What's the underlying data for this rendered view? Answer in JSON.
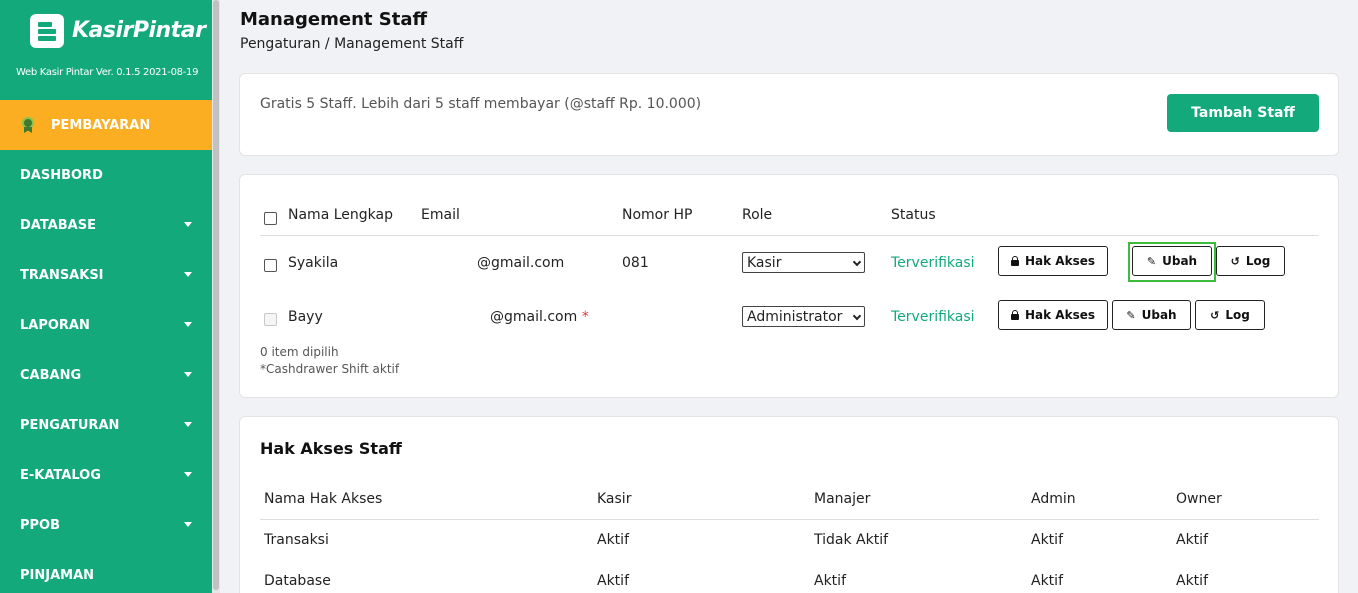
{
  "app": {
    "brand": "KasirPintar",
    "version": "Web Kasir Pintar Ver. 0.1.5 2021-08-19"
  },
  "sidebar": {
    "items": [
      {
        "label": "PEMBAYARAN",
        "active": true,
        "icon": "medal-icon"
      },
      {
        "label": "DASHBORD"
      },
      {
        "label": "DATABASE",
        "dropdown": true
      },
      {
        "label": "TRANSAKSI",
        "dropdown": true
      },
      {
        "label": "LAPORAN",
        "dropdown": true
      },
      {
        "label": "CABANG",
        "dropdown": true
      },
      {
        "label": "PENGATURAN",
        "dropdown": true
      },
      {
        "label": "E-KATALOG",
        "dropdown": true
      },
      {
        "label": "PPOB",
        "dropdown": true
      },
      {
        "label": "PINJAMAN"
      }
    ]
  },
  "header": {
    "title": "Management Staff",
    "breadcrumb": "Pengaturan / Management Staff"
  },
  "info": {
    "text": "Gratis 5 Staff. Lebih dari 5 staff membayar (@staff Rp. 10.000)",
    "add_button": "Tambah Staff"
  },
  "staff_table": {
    "headers": [
      "Nama Lengkap",
      "Email",
      "Nomor HP",
      "Role",
      "Status"
    ],
    "rows": [
      {
        "name": "Syakila",
        "email": "@gmail.com",
        "email_mark": "",
        "phone": "081",
        "role": "Kasir",
        "status": "Terverifikasi"
      },
      {
        "name": "Bayy",
        "email": "@gmail.com",
        "email_mark": "*",
        "phone": "",
        "role": "Administrator",
        "status": "Terverifikasi"
      }
    ],
    "actions": {
      "access": "Hak Akses",
      "edit": "Ubah",
      "log": "Log"
    },
    "selected_count": "0 item dipilih",
    "shift_note": "*Cashdrawer Shift aktif"
  },
  "access_section": {
    "title": "Hak Akses Staff",
    "headers": [
      "Nama Hak Akses",
      "Kasir",
      "Manajer",
      "Admin",
      "Owner"
    ],
    "rows": [
      {
        "name": "Transaksi",
        "kasir": "Aktif",
        "manajer": "Tidak Aktif",
        "admin": "Aktif",
        "owner": "Aktif"
      },
      {
        "name": "Database",
        "kasir": "Aktif",
        "manajer": "Aktif",
        "admin": "Aktif",
        "owner": "Aktif"
      }
    ]
  },
  "colors": {
    "brand": "#13a97b",
    "active_nav": "#fbae22",
    "note_red": "#e03b3b",
    "highlight": "#3dbb3d"
  }
}
